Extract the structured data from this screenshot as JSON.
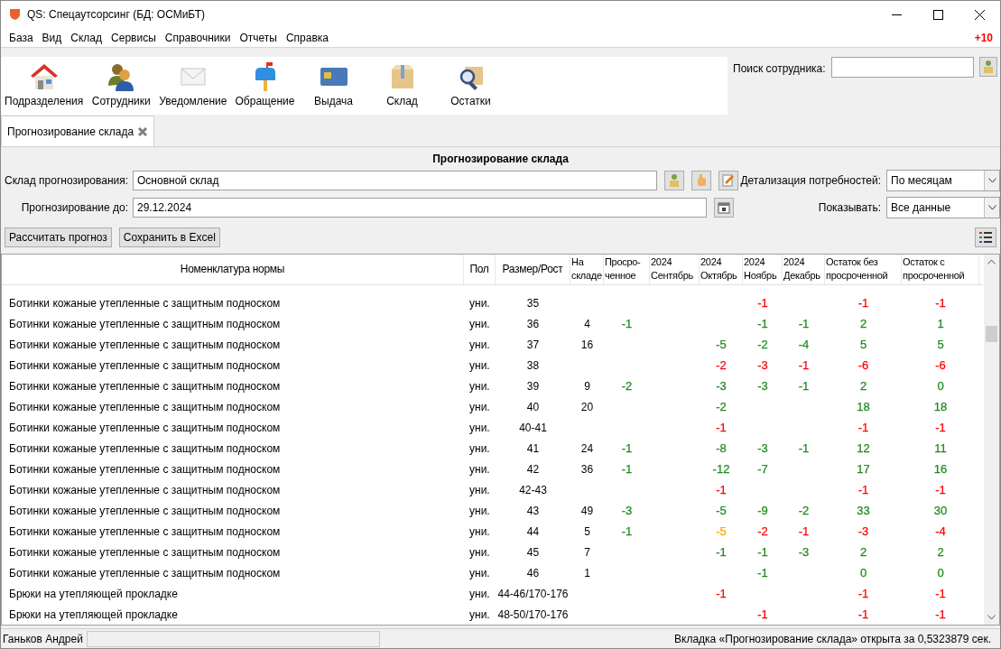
{
  "window": {
    "title": "QS: Спецаутсорсинг (БД: ОСМиБТ)"
  },
  "menu": [
    "База",
    "Вид",
    "Склад",
    "Сервисы",
    "Справочники",
    "Отчеты",
    "Справка"
  ],
  "badge": "+10",
  "toolbar": [
    {
      "label": "Подразделения"
    },
    {
      "label": "Сотрудники"
    },
    {
      "label": "Уведомление"
    },
    {
      "label": "Обращение"
    },
    {
      "label": "Выдача"
    },
    {
      "label": "Склад"
    },
    {
      "label": "Остатки"
    }
  ],
  "employee_search": {
    "label": "Поиск сотрудника:"
  },
  "tabs": [
    {
      "label": "Прогнозирование склада",
      "selected": true
    }
  ],
  "form": {
    "title": "Прогнозирование склада",
    "warehouse": {
      "label": "Склад прогнозирования:",
      "value": "Основной склад"
    },
    "detail": {
      "label": "Детализация потребностей:",
      "value": "По месяцам"
    },
    "until": {
      "label": "Прогнозирование до:",
      "value": "29.12.2024"
    },
    "show": {
      "label": "Показывать:",
      "value": "Все данные"
    }
  },
  "buttons": [
    "Рассчитать прогноз",
    "Сохранить в Excel"
  ],
  "table": {
    "columns": [
      "Номенклатура нормы",
      "Пол",
      "Размер/Рост",
      "На\nскладе",
      "Просро-\nченное",
      "2024\nСентябрь",
      "2024\nОктябрь",
      "2024\nНоябрь",
      "2024\nДекабрь",
      "Остаток без\nпросроченной",
      "Остаток с\nпросроченной"
    ],
    "rows": [
      {
        "cells": [
          "Ботинки кожаные утепленные с защитным подноском",
          "уни.",
          "35",
          "",
          "",
          "",
          "",
          {
            "text": "-1",
            "color": "#ff0000"
          },
          "",
          {
            "text": "-1",
            "color": "#ff0000"
          },
          {
            "text": "-1",
            "color": "#ff0000"
          }
        ]
      },
      {
        "cells": [
          "Ботинки кожаные утепленные с защитным подноском",
          "уни.",
          "36",
          "4",
          {
            "text": "-1",
            "color": "#1e8a1e"
          },
          "",
          "",
          {
            "text": "-1",
            "color": "#1e8a1e"
          },
          {
            "text": "-1",
            "color": "#1e8a1e"
          },
          {
            "text": "2",
            "color": "#1e8a1e"
          },
          {
            "text": "1",
            "color": "#1e8a1e"
          }
        ]
      },
      {
        "cells": [
          "Ботинки кожаные утепленные с защитным подноском",
          "уни.",
          "37",
          "16",
          "",
          "",
          {
            "text": "-5",
            "color": "#1e8a1e"
          },
          {
            "text": "-2",
            "color": "#1e8a1e"
          },
          {
            "text": "-4",
            "color": "#1e8a1e"
          },
          {
            "text": "5",
            "color": "#1e8a1e"
          },
          {
            "text": "5",
            "color": "#1e8a1e"
          }
        ]
      },
      {
        "cells": [
          "Ботинки кожаные утепленные с защитным подноском",
          "уни.",
          "38",
          "",
          "",
          "",
          {
            "text": "-2",
            "color": "#ff0000"
          },
          {
            "text": "-3",
            "color": "#ff0000"
          },
          {
            "text": "-1",
            "color": "#ff0000"
          },
          {
            "text": "-6",
            "color": "#ff0000"
          },
          {
            "text": "-6",
            "color": "#ff0000"
          }
        ]
      },
      {
        "cells": [
          "Ботинки кожаные утепленные с защитным подноском",
          "уни.",
          "39",
          "9",
          {
            "text": "-2",
            "color": "#1e8a1e"
          },
          "",
          {
            "text": "-3",
            "color": "#1e8a1e"
          },
          {
            "text": "-3",
            "color": "#1e8a1e"
          },
          {
            "text": "-1",
            "color": "#1e8a1e"
          },
          {
            "text": "2",
            "color": "#1e8a1e"
          },
          {
            "text": "0",
            "color": "#1e8a1e"
          }
        ]
      },
      {
        "cells": [
          "Ботинки кожаные утепленные с защитным подноском",
          "уни.",
          "40",
          "20",
          "",
          "",
          {
            "text": "-2",
            "color": "#1e8a1e"
          },
          "",
          "",
          {
            "text": "18",
            "color": "#1e8a1e"
          },
          {
            "text": "18",
            "color": "#1e8a1e"
          }
        ]
      },
      {
        "cells": [
          "Ботинки кожаные утепленные с защитным подноском",
          "уни.",
          "40-41",
          "",
          "",
          "",
          {
            "text": "-1",
            "color": "#ff0000"
          },
          "",
          "",
          {
            "text": "-1",
            "color": "#ff0000"
          },
          {
            "text": "-1",
            "color": "#ff0000"
          }
        ]
      },
      {
        "cells": [
          "Ботинки кожаные утепленные с защитным подноском",
          "уни.",
          "41",
          "24",
          {
            "text": "-1",
            "color": "#1e8a1e"
          },
          "",
          {
            "text": "-8",
            "color": "#1e8a1e"
          },
          {
            "text": "-3",
            "color": "#1e8a1e"
          },
          {
            "text": "-1",
            "color": "#1e8a1e"
          },
          {
            "text": "12",
            "color": "#1e8a1e"
          },
          {
            "text": "11",
            "color": "#1e8a1e"
          }
        ]
      },
      {
        "cells": [
          "Ботинки кожаные утепленные с защитным подноском",
          "уни.",
          "42",
          "36",
          {
            "text": "-1",
            "color": "#1e8a1e"
          },
          "",
          {
            "text": "-12",
            "color": "#1e8a1e"
          },
          {
            "text": "-7",
            "color": "#1e8a1e"
          },
          "",
          {
            "text": "17",
            "color": "#1e8a1e"
          },
          {
            "text": "16",
            "color": "#1e8a1e"
          }
        ]
      },
      {
        "cells": [
          "Ботинки кожаные утепленные с защитным подноском",
          "уни.",
          "42-43",
          "",
          "",
          "",
          {
            "text": "-1",
            "color": "#ff0000"
          },
          "",
          "",
          {
            "text": "-1",
            "color": "#ff0000"
          },
          {
            "text": "-1",
            "color": "#ff0000"
          }
        ]
      },
      {
        "cells": [
          "Ботинки кожаные утепленные с защитным подноском",
          "уни.",
          "43",
          "49",
          {
            "text": "-3",
            "color": "#1e8a1e"
          },
          "",
          {
            "text": "-5",
            "color": "#1e8a1e"
          },
          {
            "text": "-9",
            "color": "#1e8a1e"
          },
          {
            "text": "-2",
            "color": "#1e8a1e"
          },
          {
            "text": "33",
            "color": "#1e8a1e"
          },
          {
            "text": "30",
            "color": "#1e8a1e"
          }
        ]
      },
      {
        "cells": [
          "Ботинки кожаные утепленные с защитным подноском",
          "уни.",
          "44",
          "5",
          {
            "text": "-1",
            "color": "#1e8a1e"
          },
          "",
          {
            "text": "-5",
            "color": "#ffa500"
          },
          {
            "text": "-2",
            "color": "#ff0000"
          },
          {
            "text": "-1",
            "color": "#ff0000"
          },
          {
            "text": "-3",
            "color": "#ff0000"
          },
          {
            "text": "-4",
            "color": "#ff0000"
          }
        ]
      },
      {
        "cells": [
          "Ботинки кожаные утепленные с защитным подноском",
          "уни.",
          "45",
          "7",
          "",
          "",
          {
            "text": "-1",
            "color": "#1e8a1e"
          },
          {
            "text": "-1",
            "color": "#1e8a1e"
          },
          {
            "text": "-3",
            "color": "#1e8a1e"
          },
          {
            "text": "2",
            "color": "#1e8a1e"
          },
          {
            "text": "2",
            "color": "#1e8a1e"
          }
        ]
      },
      {
        "cells": [
          "Ботинки кожаные утепленные с защитным подноском",
          "уни.",
          "46",
          "1",
          "",
          "",
          "",
          {
            "text": "-1",
            "color": "#1e8a1e"
          },
          "",
          {
            "text": "0",
            "color": "#1e8a1e"
          },
          {
            "text": "0",
            "color": "#1e8a1e"
          }
        ]
      },
      {
        "cells": [
          "Брюки на утепляющей прокладке",
          "уни.",
          "44-46/170-176",
          "",
          "",
          "",
          {
            "text": "-1",
            "color": "#ff0000"
          },
          "",
          "",
          {
            "text": "-1",
            "color": "#ff0000"
          },
          {
            "text": "-1",
            "color": "#ff0000"
          }
        ]
      },
      {
        "cells": [
          "Брюки на утепляющей прокладке",
          "уни.",
          "48-50/170-176",
          "",
          "",
          "",
          "",
          {
            "text": "-1",
            "color": "#ff0000"
          },
          "",
          {
            "text": "-1",
            "color": "#ff0000"
          },
          {
            "text": "-1",
            "color": "#ff0000"
          }
        ]
      }
    ]
  },
  "status_bar": {
    "user": "Ганьков Андрей",
    "message": "Вкладка «Прогнозирование склада» открыта за 0,5323879 сек."
  }
}
